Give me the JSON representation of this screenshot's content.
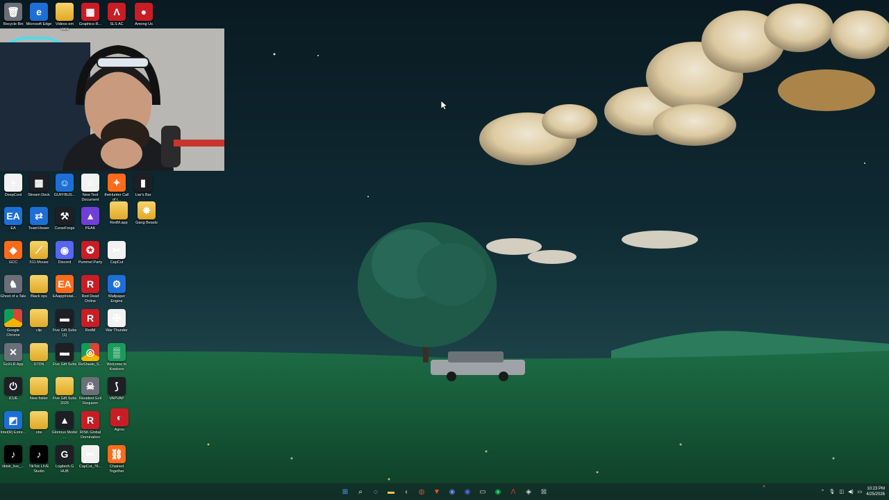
{
  "desktop_icons": [
    {
      "id": "recycle-bin",
      "label": "Recycle Bin",
      "icon": "recycle-bin-icon",
      "glyph": "🗑",
      "style": "g-gray"
    },
    {
      "id": "microsoft-edge",
      "label": "Microsoft Edge",
      "icon": "edge-icon",
      "glyph": "e",
      "style": "g-blue"
    },
    {
      "id": "videos-folder",
      "label": "Videos em vaca",
      "icon": "folder-icon",
      "glyph": "",
      "style": "g-folder"
    },
    {
      "id": "graphics-r",
      "label": "Graphics-R...",
      "icon": "archive-icon",
      "glyph": "▦",
      "style": "g-red"
    },
    {
      "id": "sls-ac",
      "label": "SLS AC",
      "icon": "sls-ac-icon",
      "glyph": "Λ",
      "style": "g-red"
    },
    {
      "id": "among-us",
      "label": "Among Us",
      "icon": "among-us-icon",
      "glyph": "●",
      "style": "g-red"
    },
    {
      "id": "deepcool",
      "label": "DeepCool",
      "icon": "deepcool-icon",
      "glyph": "+",
      "style": "g-white"
    },
    {
      "id": "stream-deck",
      "label": "Stream Deck",
      "icon": "stream-deck-icon",
      "glyph": "▦",
      "style": "g-dark"
    },
    {
      "id": "geforce",
      "label": "GUFFBUS...",
      "icon": "character-icon",
      "glyph": "☺",
      "style": "g-blue"
    },
    {
      "id": "new-text",
      "label": "New Text Document",
      "icon": "text-document-icon",
      "glyph": "≡",
      "style": "g-white"
    },
    {
      "id": "thehunter",
      "label": "theHunter Call of t...",
      "icon": "thehunter-icon",
      "glyph": "✦",
      "style": "g-orange"
    },
    {
      "id": "liars-bar",
      "label": "Liar's Bar",
      "icon": "liars-bar-icon",
      "glyph": "▮",
      "style": "g-dark"
    },
    {
      "id": "ea",
      "label": "EA",
      "icon": "ea-icon",
      "glyph": "EA",
      "style": "g-blue"
    },
    {
      "id": "teamviewer",
      "label": "TeamViewer",
      "icon": "teamviewer-icon",
      "glyph": "⇄",
      "style": "g-blue"
    },
    {
      "id": "curseforge",
      "label": "CurseForge",
      "icon": "curseforge-icon",
      "glyph": "⚒",
      "style": "g-dark"
    },
    {
      "id": "peak",
      "label": "PEAK",
      "icon": "peak-icon",
      "glyph": "▲",
      "style": "g-purple"
    },
    {
      "id": "redm-app",
      "label": "RedM.app",
      "icon": "folder-icon",
      "glyph": "",
      "style": "g-folder"
    },
    {
      "id": "gang-beasts",
      "label": "Gang Beasts",
      "icon": "gang-beasts-icon",
      "glyph": "✸",
      "style": "g-folder"
    },
    {
      "id": "gcc",
      "label": "GCC",
      "icon": "gcc-icon",
      "glyph": "◆",
      "style": "g-orange"
    },
    {
      "id": "x11-mouse",
      "label": "X11 Mouse",
      "icon": "mouse-icon",
      "glyph": "⟋",
      "style": "g-folder"
    },
    {
      "id": "discord",
      "label": "Discord",
      "icon": "discord-icon",
      "glyph": "◉",
      "style": "g-discord"
    },
    {
      "id": "pummel-party",
      "label": "Pummel Party",
      "icon": "pummel-party-icon",
      "glyph": "✪",
      "style": "g-red"
    },
    {
      "id": "capcut",
      "label": "CapCut",
      "icon": "capcut-icon",
      "glyph": "✂",
      "style": "g-white"
    },
    {
      "id": "ghost-of-a-tale",
      "label": "Ghost of a Tale",
      "icon": "ghost-of-a-tale-icon",
      "glyph": "♞",
      "style": "g-gray"
    },
    {
      "id": "black-ops",
      "label": "Black ops",
      "icon": "folder-icon",
      "glyph": "",
      "style": "g-folder"
    },
    {
      "id": "eappinstaller",
      "label": "EAappInstal...",
      "icon": "ea-icon",
      "glyph": "EA",
      "style": "g-orange"
    },
    {
      "id": "red-dead-online",
      "label": "Red Dead Online",
      "icon": "red-dead-icon",
      "glyph": "R",
      "style": "g-red"
    },
    {
      "id": "wallpaper-engine",
      "label": "Wallpaper Engine",
      "icon": "wallpaper-engine-icon",
      "glyph": "⚙",
      "style": "g-blue"
    },
    {
      "id": "google-chrome",
      "label": "Google Chrome",
      "icon": "chrome-icon",
      "glyph": "",
      "style": "g-chrome"
    },
    {
      "id": "clip",
      "label": "clip",
      "icon": "folder-icon",
      "glyph": "",
      "style": "g-folder"
    },
    {
      "id": "five-gift-subs-1",
      "label": "Five Gift Subs (1)",
      "icon": "video-file-icon",
      "glyph": "▬",
      "style": "g-dark"
    },
    {
      "id": "redm",
      "label": "RedM",
      "icon": "redm-icon",
      "glyph": "R",
      "style": "g-red"
    },
    {
      "id": "war-thunder",
      "label": "War Thunder",
      "icon": "war-thunder-icon",
      "glyph": "✠",
      "style": "g-white"
    },
    {
      "id": "goxlr-app",
      "label": "GoXLR App",
      "icon": "goxlr-icon",
      "glyph": "✕",
      "style": "g-gray"
    },
    {
      "id": "d7dn",
      "label": "D7DN",
      "icon": "folder-icon",
      "glyph": "",
      "style": "g-folder"
    },
    {
      "id": "five-gift-subs",
      "label": "Five Gift Subs",
      "icon": "video-file-icon",
      "glyph": "▬",
      "style": "g-dark"
    },
    {
      "id": "reshade",
      "label": "ReShade_S...",
      "icon": "reshade-icon",
      "glyph": "◎",
      "style": "g-chrome"
    },
    {
      "id": "welcome-kowloon",
      "label": "Welcome to Kowloon",
      "icon": "kowloon-icon",
      "glyph": "▒",
      "style": "g-green"
    },
    {
      "id": "icue",
      "label": "iCUE",
      "icon": "icue-icon",
      "glyph": "⏻",
      "style": "g-dark"
    },
    {
      "id": "new-folder",
      "label": "New folder",
      "icon": "folder-icon",
      "glyph": "",
      "style": "g-folder"
    },
    {
      "id": "five-gift-subs-2025",
      "label": "Five Gift Subs 2025",
      "icon": "folder-icon",
      "glyph": "",
      "style": "g-folder"
    },
    {
      "id": "resident-evil-requiem",
      "label": "Resident Evil Requiem",
      "icon": "resident-evil-icon",
      "glyph": "☠",
      "style": "g-gray"
    },
    {
      "id": "vapvap",
      "label": "VAPVAP",
      "icon": "vapvap-icon",
      "glyph": "⟆",
      "style": "g-dark"
    },
    {
      "id": "intel-extreme",
      "label": "Intel(R) Extre...",
      "icon": "intel-icon",
      "glyph": "◩",
      "style": "g-blue"
    },
    {
      "id": "obs",
      "label": "obs",
      "icon": "folder-icon",
      "glyph": "",
      "style": "g-folder"
    },
    {
      "id": "glorious-model",
      "label": "Glorious Model ...",
      "icon": "glorious-icon",
      "glyph": "▲",
      "style": "g-dark"
    },
    {
      "id": "risk-global-domination",
      "label": "RISK Global Domination",
      "icon": "risk-icon",
      "glyph": "R",
      "style": "g-red"
    },
    {
      "id": "agrou",
      "label": "Agrou",
      "icon": "agrou-icon",
      "glyph": "◐",
      "style": "g-red"
    },
    {
      "id": "tiktok-live",
      "label": "tiktok_live_...",
      "icon": "tiktok-icon",
      "glyph": "♪",
      "style": "g-tiktok"
    },
    {
      "id": "tiktok-live-studio",
      "label": "TikTok LIVE Studio",
      "icon": "tiktok-icon",
      "glyph": "♪",
      "style": "g-tiktok"
    },
    {
      "id": "logitech-g-hub",
      "label": "Logitech G HUB",
      "icon": "logitech-icon",
      "glyph": "G",
      "style": "g-dark"
    },
    {
      "id": "capcut-76",
      "label": "CapCut_76...",
      "icon": "capcut-icon",
      "glyph": "✂",
      "style": "g-white"
    },
    {
      "id": "chained-together",
      "label": "Chained Together",
      "icon": "chained-together-icon",
      "glyph": "⛓",
      "style": "g-orange"
    }
  ],
  "taskbar": {
    "apps": [
      {
        "id": "start",
        "icon": "windows-start-icon",
        "glyph": "⊞",
        "color": "#4aa8ff"
      },
      {
        "id": "search",
        "icon": "search-icon",
        "glyph": "⌕",
        "color": "#ffffff"
      },
      {
        "id": "copilot",
        "icon": "copilot-icon",
        "glyph": "◌",
        "color": "#d8e4ff"
      },
      {
        "id": "explorer",
        "icon": "file-explorer-icon",
        "glyph": "▬",
        "color": "#f6c54a"
      },
      {
        "id": "back-app",
        "icon": "arrow-app-icon",
        "glyph": "‹",
        "color": "#ffffff"
      },
      {
        "id": "chrome",
        "icon": "chrome-icon",
        "glyph": "◍",
        "color": "#e44b3c"
      },
      {
        "id": "brave",
        "icon": "brave-icon",
        "glyph": "▼",
        "color": "#fb542b"
      },
      {
        "id": "app-blue",
        "icon": "app-icon",
        "glyph": "◉",
        "color": "#6b8cff"
      },
      {
        "id": "discord",
        "icon": "discord-icon",
        "glyph": "◉",
        "color": "#5865f2"
      },
      {
        "id": "app-gray",
        "icon": "app-icon",
        "glyph": "▭",
        "color": "#cfd3d8"
      },
      {
        "id": "spotify",
        "icon": "spotify-icon",
        "glyph": "◉",
        "color": "#1ed760"
      },
      {
        "id": "sls-ac",
        "icon": "sls-ac-icon",
        "glyph": "Λ",
        "color": "#e03a3a"
      },
      {
        "id": "steam",
        "icon": "steam-icon",
        "glyph": "◈",
        "color": "#c7d5e0"
      },
      {
        "id": "app-x",
        "icon": "app-icon",
        "glyph": "⊠",
        "color": "#aab4bc"
      }
    ],
    "clock_time": "10:23 PM",
    "clock_date": "4/25/2026"
  }
}
